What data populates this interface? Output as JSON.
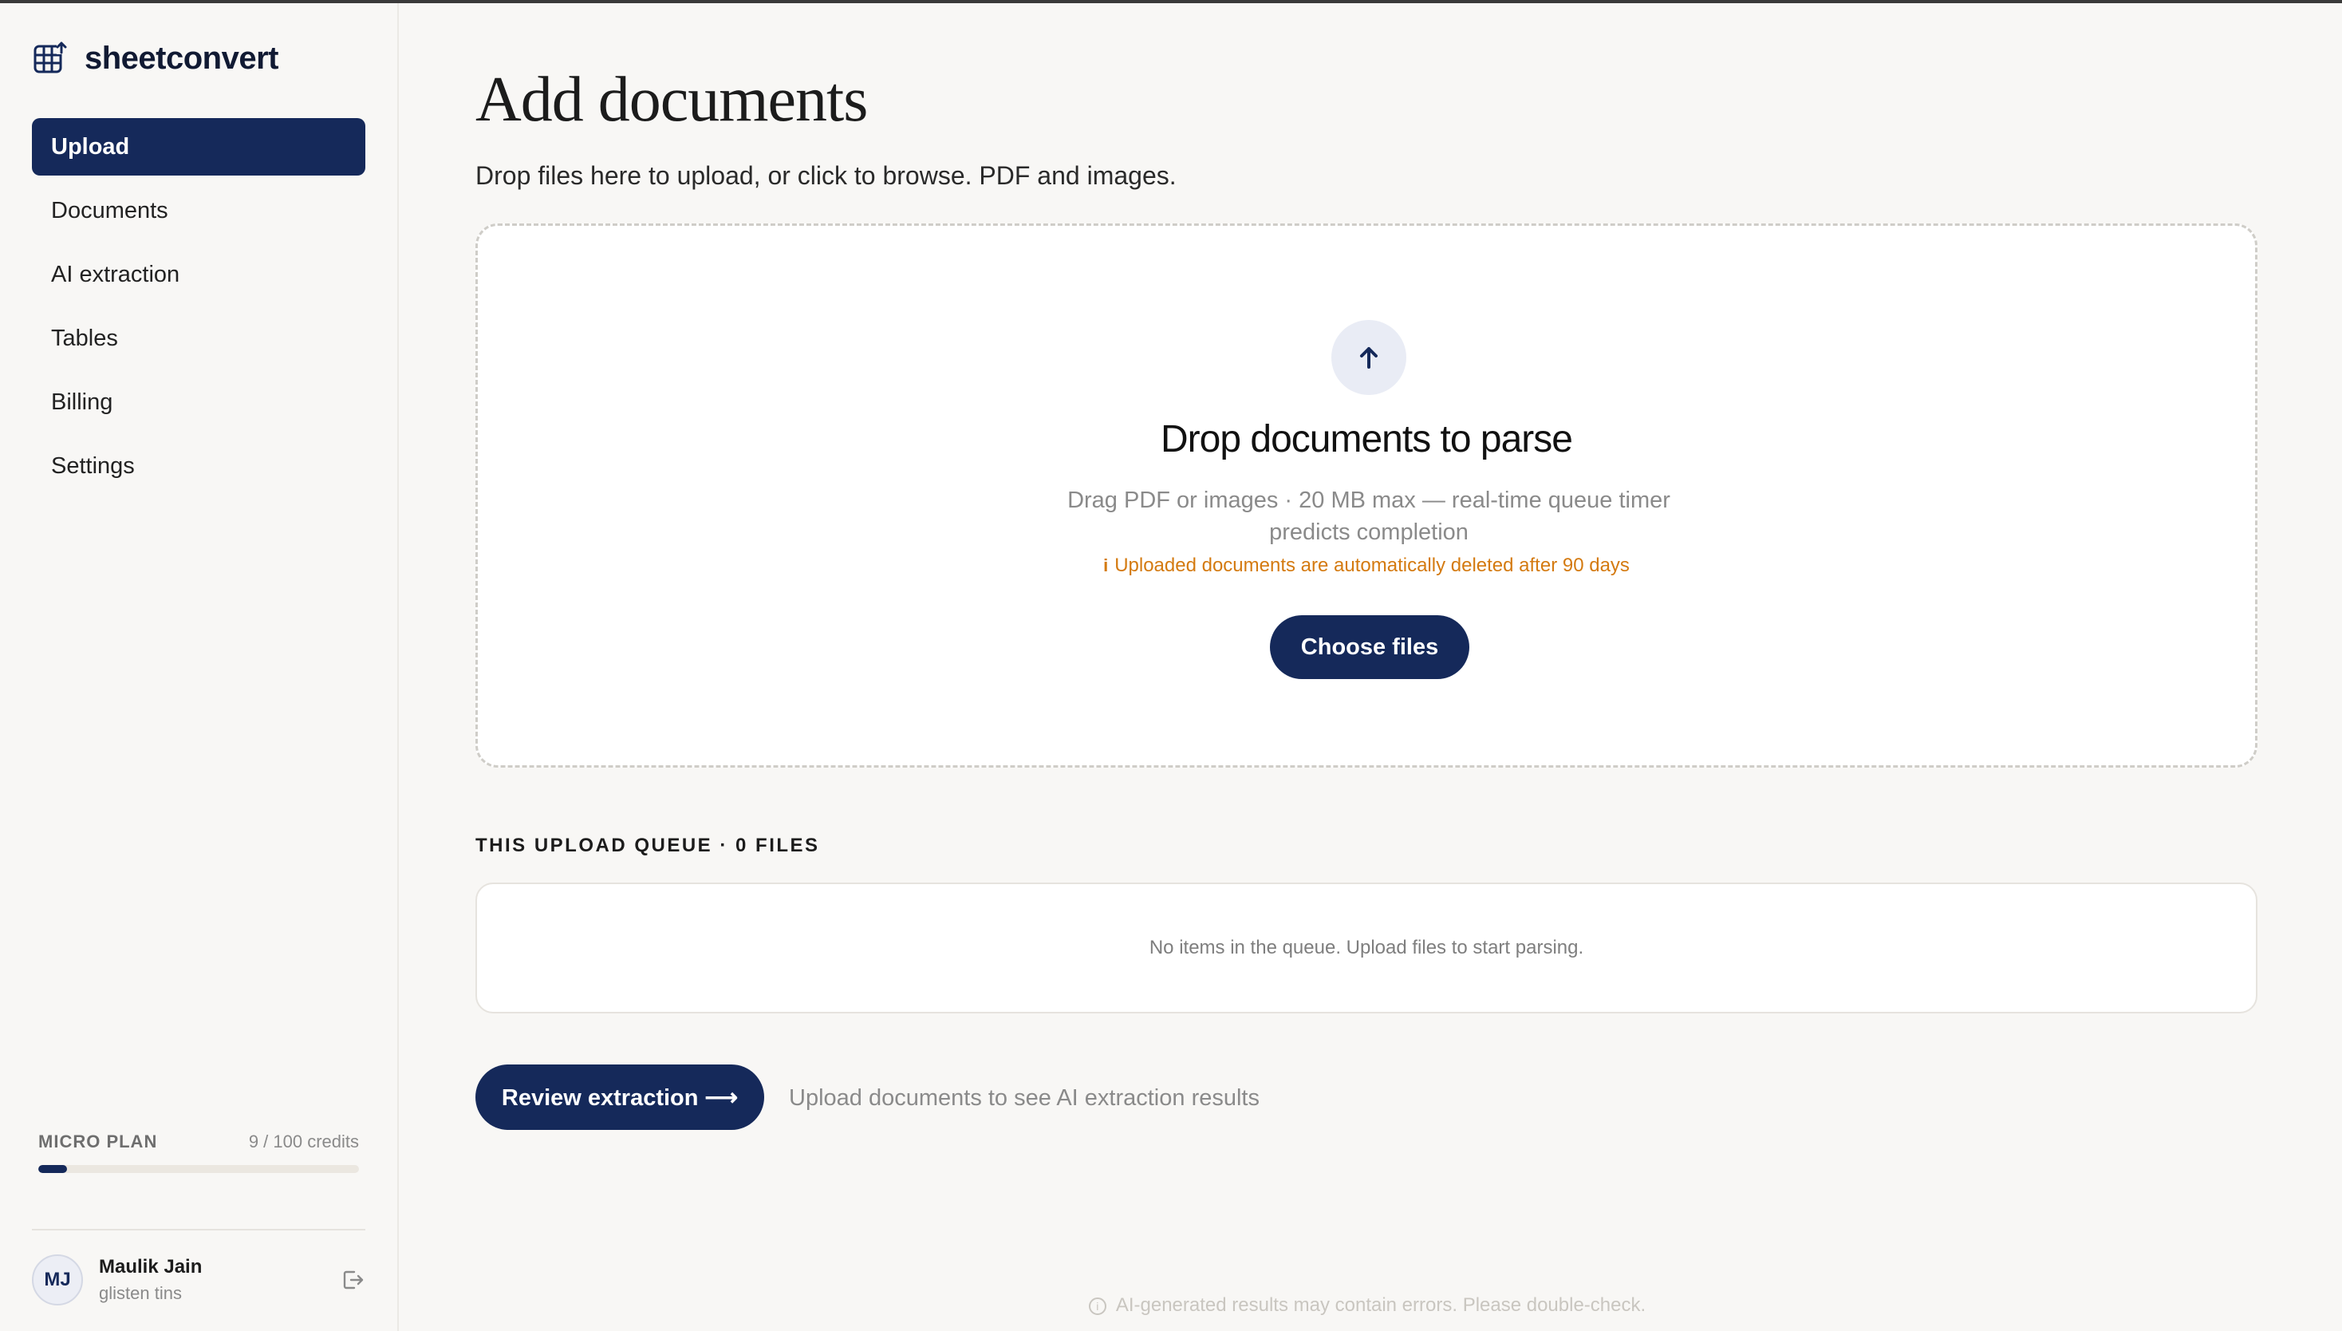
{
  "app": {
    "name": "sheetconvert",
    "logo_icon": "grid-upload-icon"
  },
  "sidebar": {
    "items": [
      {
        "label": "Upload",
        "active": true
      },
      {
        "label": "Documents",
        "active": false
      },
      {
        "label": "AI extraction",
        "active": false
      },
      {
        "label": "Tables",
        "active": false
      },
      {
        "label": "Billing",
        "active": false
      },
      {
        "label": "Settings",
        "active": false
      }
    ],
    "plan": {
      "name": "MICRO PLAN",
      "credits": "9 / 100 credits",
      "used_fraction": 0.09
    },
    "user": {
      "initials": "MJ",
      "name": "Maulik Jain",
      "subtitle": "glisten tins",
      "logout_icon": "logout-icon"
    }
  },
  "main": {
    "title": "Add documents",
    "subtitle": "Drop files here to upload, or click to browse. PDF and images.",
    "dropzone": {
      "icon": "arrow-up-icon",
      "title": "Drop documents to parse",
      "description": "Drag PDF or images · 20 MB max — real-time queue timer predicts completion",
      "warning_icon": "i",
      "warning": "Uploaded documents are automatically deleted after 90 days",
      "button_label": "Choose files"
    },
    "queue": {
      "label": "THIS UPLOAD QUEUE · 0 FILES",
      "empty_message": "No items in the queue. Upload files to start parsing."
    },
    "review": {
      "button_label": "Review extraction ⟶",
      "hint": "Upload documents to see AI extraction results"
    },
    "footer_note": "AI-generated results may contain errors. Please double-check.",
    "footer_icon": "i"
  },
  "colors": {
    "primary": "#15295a",
    "warning": "#d47a10",
    "background": "#f8f7f5"
  }
}
